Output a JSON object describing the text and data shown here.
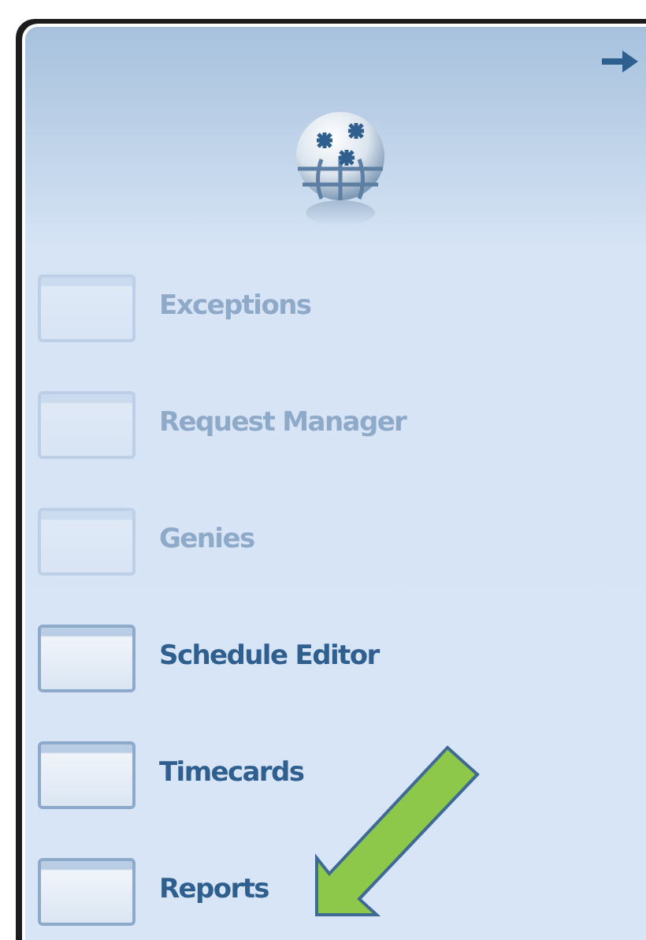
{
  "navigation_panel": {
    "items": [
      {
        "label": "Exceptions",
        "disabled": true
      },
      {
        "label": "Request Manager",
        "disabled": true
      },
      {
        "label": "Genies",
        "disabled": true
      },
      {
        "label": "Schedule Editor",
        "disabled": false
      },
      {
        "label": "Timecards",
        "disabled": false
      },
      {
        "label": "Reports",
        "disabled": false
      }
    ]
  }
}
